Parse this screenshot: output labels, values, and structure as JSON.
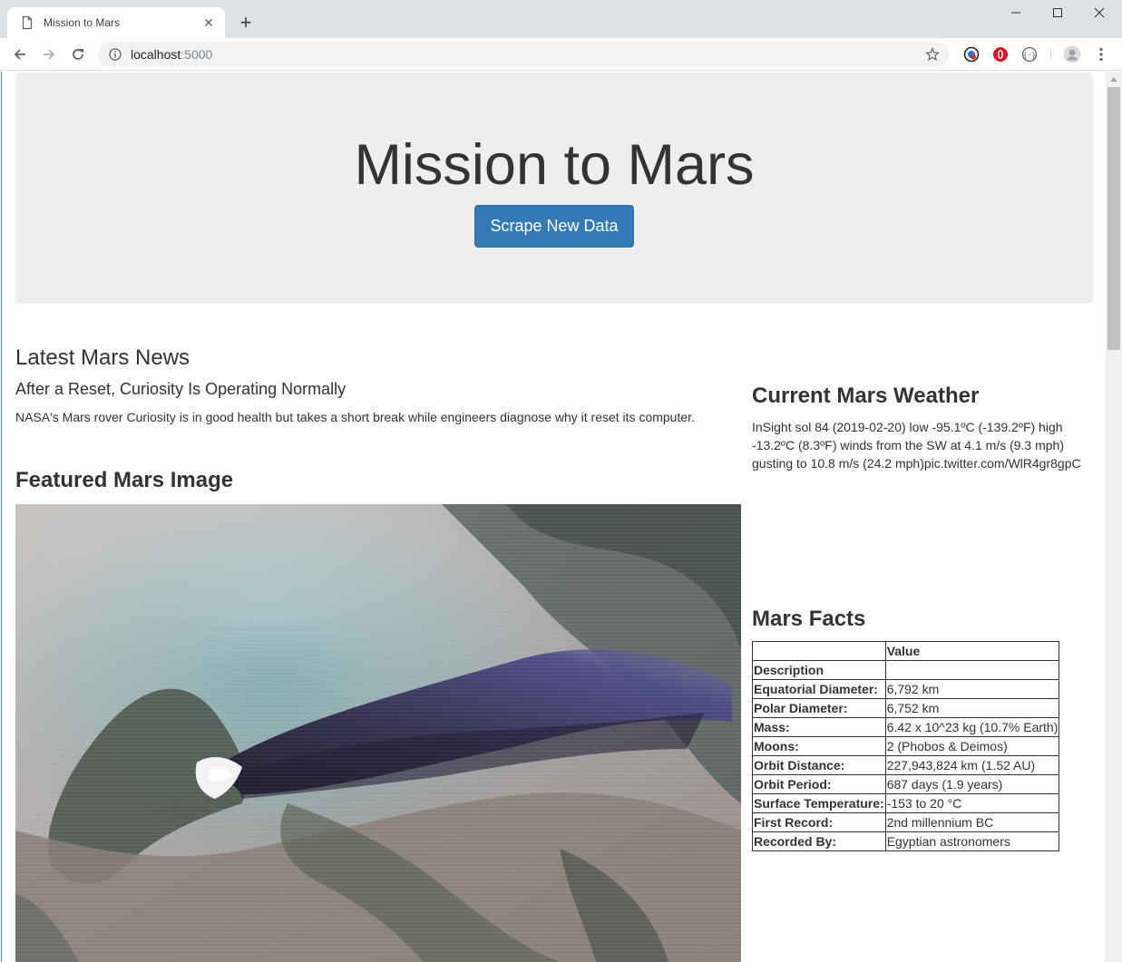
{
  "browser": {
    "tab_title": "Mission to Mars",
    "url_host": "localhost",
    "url_port": ":5000"
  },
  "jumbotron": {
    "title": "Mission to Mars",
    "button_label": "Scrape New Data"
  },
  "news": {
    "heading": "Latest Mars News",
    "title": "After a Reset, Curiosity Is Operating Normally",
    "body": "NASA's Mars rover Curiosity is in good health but takes a short break while engineers diagnose why it reset its computer."
  },
  "featured": {
    "heading": "Featured Mars Image"
  },
  "weather": {
    "heading": "Current Mars Weather",
    "text": "InSight sol 84 (2019-02-20) low -95.1ºC (-139.2ºF) high -13.2ºC (8.3ºF) winds from the SW at 4.1 m/s (9.3 mph) gusting to 10.8 m/s (24.2 mph)pic.twitter.com/WlR4gr8gpC"
  },
  "facts": {
    "heading": "Mars Facts",
    "header_col1": "",
    "header_col2": "Value",
    "index_label": "Description",
    "rows": [
      {
        "label": "Equatorial Diameter:",
        "value": "6,792 km"
      },
      {
        "label": "Polar Diameter:",
        "value": "6,752 km"
      },
      {
        "label": "Mass:",
        "value": "6.42 x 10^23 kg (10.7% Earth)"
      },
      {
        "label": "Moons:",
        "value": "2 (Phobos & Deimos)"
      },
      {
        "label": "Orbit Distance:",
        "value": "227,943,824 km (1.52 AU)"
      },
      {
        "label": "Orbit Period:",
        "value": "687 days (1.9 years)"
      },
      {
        "label": "Surface Temperature:",
        "value": "-153 to 20 °C"
      },
      {
        "label": "First Record:",
        "value": "2nd millennium BC"
      },
      {
        "label": "Recorded By:",
        "value": "Egyptian astronomers"
      }
    ]
  }
}
